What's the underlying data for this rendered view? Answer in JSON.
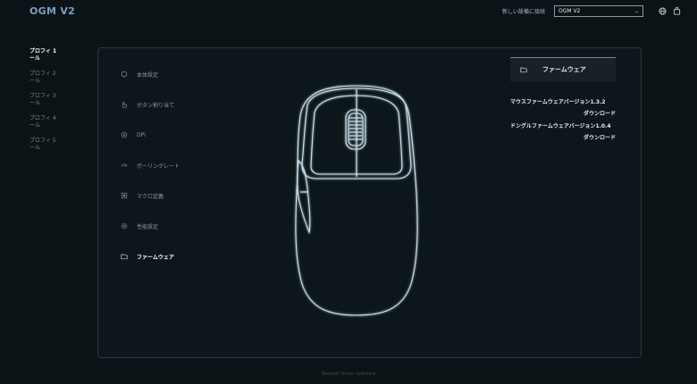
{
  "app": {
    "title": "OGM V2"
  },
  "header": {
    "connect_label": "新しい設備に接続",
    "device_select": {
      "value": "OGM V2"
    },
    "icons": [
      "globe-icon",
      "bag-icon"
    ]
  },
  "profiles": [
    {
      "label": "プロフィ 1 ール",
      "active": true
    },
    {
      "label": "プロフィ 2 ール",
      "active": false
    },
    {
      "label": "プロフィ 3 ール",
      "active": false
    },
    {
      "label": "プロフィ 4 ール",
      "active": false
    },
    {
      "label": "プロフィ 5 ール",
      "active": false
    }
  ],
  "menu": [
    {
      "label": "本体設定",
      "icon": "circle-icon",
      "active": false
    },
    {
      "label": "ボタン割り当て",
      "icon": "pointer-hand-icon",
      "active": false
    },
    {
      "label": "DPI",
      "icon": "target-icon",
      "active": false
    },
    {
      "label": "ポーリングレート",
      "icon": "gauge-icon",
      "active": false
    },
    {
      "label": "マクロ定義",
      "icon": "macro-icon",
      "active": false
    },
    {
      "label": "性能設定",
      "icon": "settings-icon",
      "active": false
    },
    {
      "label": "ファームウェア",
      "icon": "folder-icon",
      "active": true
    }
  ],
  "firmware": {
    "header": "ファームウェア",
    "mouse_version_label": "マウスファームウェアバージョン1.3.2",
    "mouse_download": "ダウンロード",
    "dongle_version_label": "ドングルファームウェアバージョン1.0.4",
    "dongle_download": "ダウンロード"
  },
  "footer": {
    "text": "Waizowl Driver Software"
  },
  "colors": {
    "background": "#0b1317",
    "accent": "#7e9fbd",
    "panel_border": "#2b363c"
  }
}
